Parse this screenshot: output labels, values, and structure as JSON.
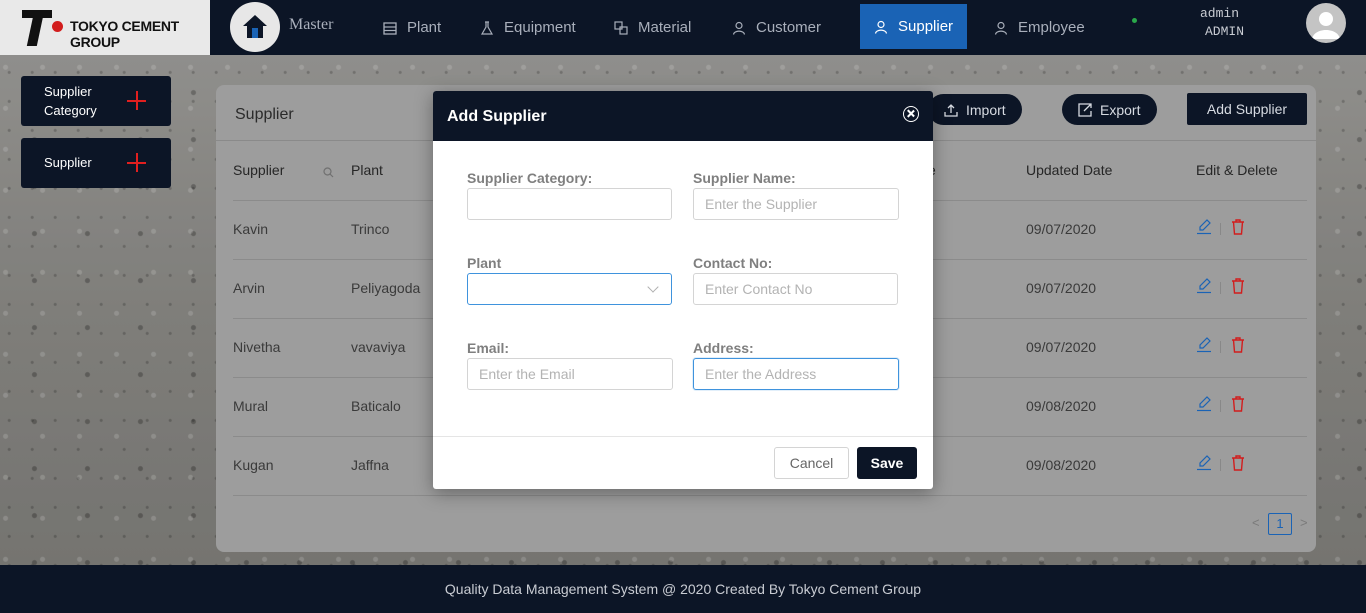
{
  "brand": {
    "name": "TOKYO CEMENT GROUP"
  },
  "nav": {
    "master": "Master",
    "items": [
      {
        "label": "Plant",
        "icon": "building-icon"
      },
      {
        "label": "Equipment",
        "icon": "flask-icon"
      },
      {
        "label": "Material",
        "icon": "blocks-icon"
      },
      {
        "label": "Customer",
        "icon": "user-icon"
      },
      {
        "label": "Supplier",
        "icon": "user-icon",
        "active": true
      },
      {
        "label": "Employee",
        "icon": "user-icon"
      }
    ],
    "user_name": "admin",
    "user_role": "ADMIN"
  },
  "sidebar": {
    "buttons": [
      {
        "label_line1": "Supplier",
        "label_line2": "Category"
      },
      {
        "label_line1": "Supplier",
        "label_line2": ""
      }
    ]
  },
  "card": {
    "title": "Supplier",
    "import_label": "Import",
    "export_label": "Export",
    "add_label": "Add Supplier",
    "columns": [
      "Supplier",
      "Plant",
      "e",
      "Updated Date",
      "Edit & Delete"
    ],
    "rows": [
      {
        "supplier": "Kavin",
        "plant": "Trinco",
        "updated": "09/07/2020"
      },
      {
        "supplier": "Arvin",
        "plant": "Peliyagoda",
        "updated": "09/07/2020"
      },
      {
        "supplier": "Nivetha",
        "plant": "vavaviya",
        "updated": "09/07/2020"
      },
      {
        "supplier": "Mural",
        "plant": "Baticalo",
        "updated": "09/08/2020"
      },
      {
        "supplier": "Kugan",
        "plant": "Jaffna",
        "updated": "09/08/2020"
      }
    ],
    "pagination": {
      "prev": "<",
      "current": "1",
      "next": ">"
    }
  },
  "modal": {
    "title": "Add Supplier",
    "fields": {
      "category": {
        "label": "Supplier Category:",
        "placeholder": ""
      },
      "name": {
        "label": "Supplier Name:",
        "placeholder": "Enter the Supplier"
      },
      "plant": {
        "label": "Plant",
        "placeholder": ""
      },
      "contact": {
        "label": "Contact No:",
        "placeholder": "Enter Contact No"
      },
      "email": {
        "label": "Email:",
        "placeholder": "Enter the Email"
      },
      "address": {
        "label": "Address:",
        "placeholder": "Enter the Address"
      }
    },
    "cancel_label": "Cancel",
    "save_label": "Save"
  },
  "footer": {
    "text": "Quality Data Management System @ 2020 Created By Tokyo Cement Group"
  },
  "colors": {
    "navy": "#0c1526",
    "accent_blue": "#1a63b5",
    "delete_red": "#d21d1d"
  }
}
